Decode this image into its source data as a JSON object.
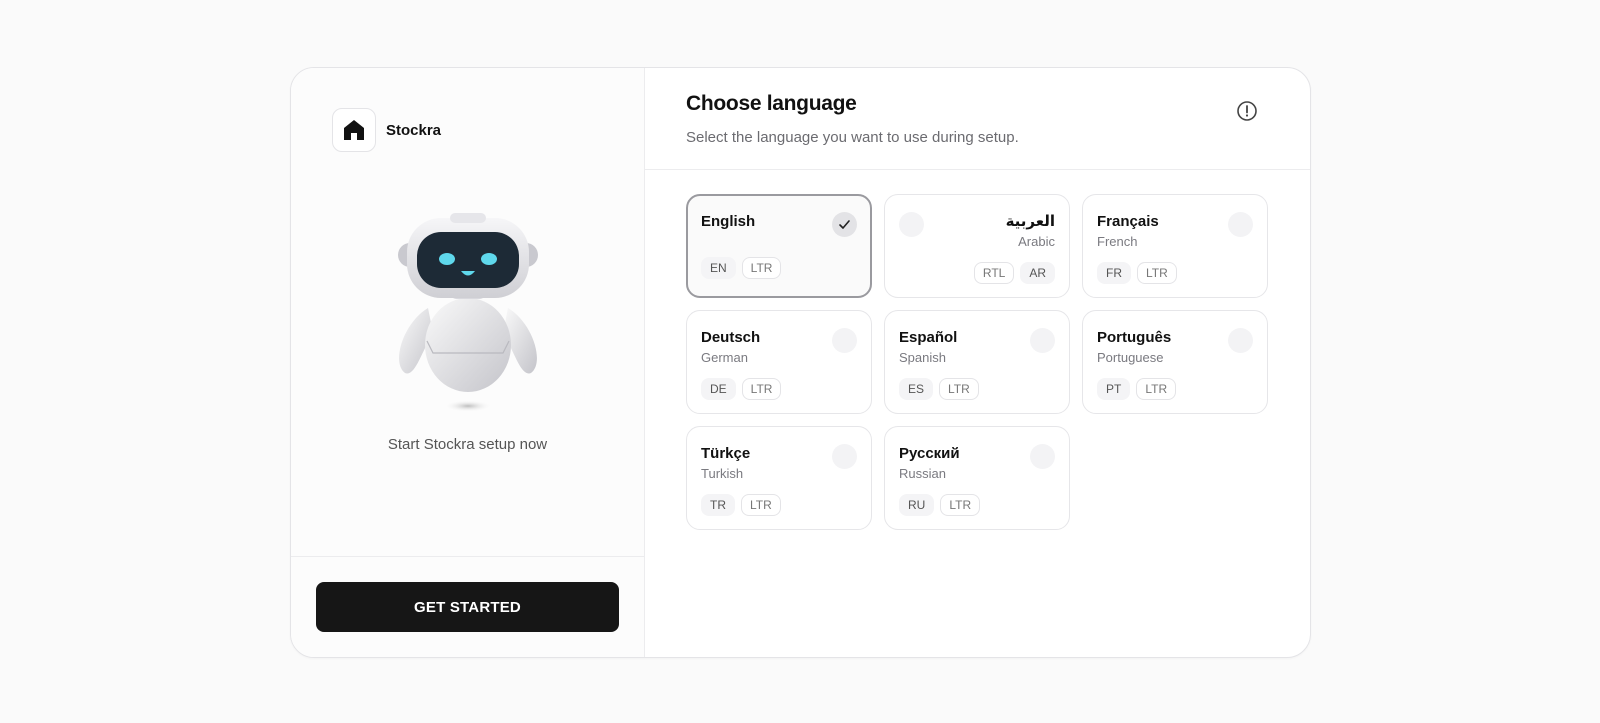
{
  "brand": {
    "name": "Stockra",
    "logo_icon": "home-icon"
  },
  "left": {
    "tagline": "Start Stockra setup now",
    "illustration": "robot-mascot",
    "cta_label": "GET STARTED"
  },
  "header": {
    "title": "Choose language",
    "subtitle": "Select the language you want to use during setup.",
    "info_icon": "info-icon"
  },
  "languages": [
    {
      "native": "English",
      "english": "",
      "code": "EN",
      "dir": "LTR",
      "selected": true
    },
    {
      "native": "العربية",
      "english": "Arabic",
      "code": "AR",
      "dir": "RTL",
      "selected": false
    },
    {
      "native": "Français",
      "english": "French",
      "code": "FR",
      "dir": "LTR",
      "selected": false
    },
    {
      "native": "Deutsch",
      "english": "German",
      "code": "DE",
      "dir": "LTR",
      "selected": false
    },
    {
      "native": "Español",
      "english": "Spanish",
      "code": "ES",
      "dir": "LTR",
      "selected": false
    },
    {
      "native": "Português",
      "english": "Portuguese",
      "code": "PT",
      "dir": "LTR",
      "selected": false
    },
    {
      "native": "Türkçe",
      "english": "Turkish",
      "code": "TR",
      "dir": "LTR",
      "selected": false
    },
    {
      "native": "Русский",
      "english": "Russian",
      "code": "RU",
      "dir": "LTR",
      "selected": false
    }
  ],
  "colors": {
    "primary_button": "#161616",
    "selected_border": "#9a9a9f",
    "robot_eye": "#5fd8ec"
  }
}
